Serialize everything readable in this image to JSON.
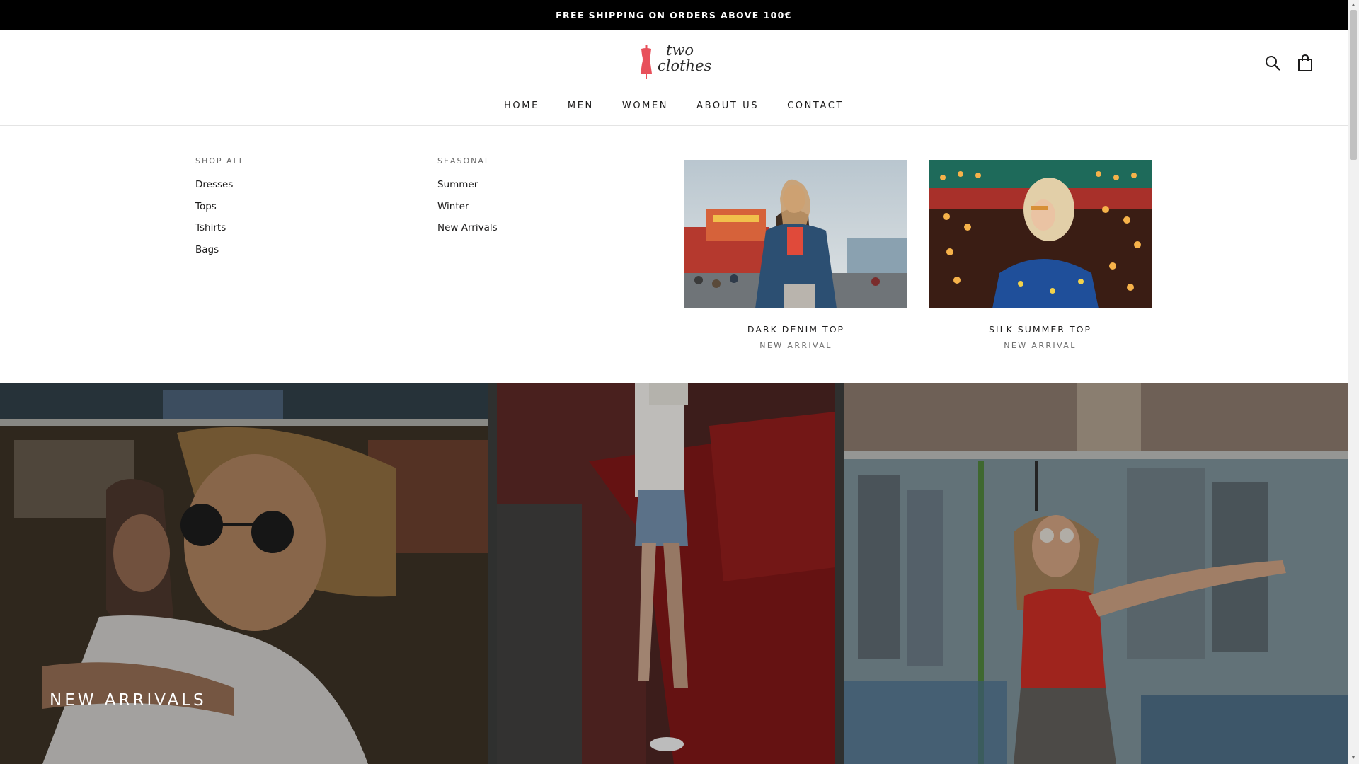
{
  "announcement": "FREE SHIPPING ON ORDERS ABOVE 100€",
  "brand": {
    "line1": "two",
    "line2": "clothes",
    "accent": "#e8505b"
  },
  "nav": {
    "items": [
      {
        "label": "HOME",
        "state": "active"
      },
      {
        "label": "MEN",
        "state": ""
      },
      {
        "label": "WOMEN",
        "state": "open"
      },
      {
        "label": "ABOUT US",
        "state": ""
      },
      {
        "label": "CONTACT",
        "state": ""
      }
    ]
  },
  "header_icons": [
    "search-icon",
    "shopping-bag-icon"
  ],
  "mega_menu": {
    "shop_all": {
      "title": "SHOP ALL",
      "links": [
        "Dresses",
        "Tops",
        "Tshirts",
        "Bags"
      ]
    },
    "seasonal": {
      "title": "SEASONAL",
      "links": [
        "Summer",
        "Winter",
        "New Arrivals"
      ]
    },
    "promos": [
      {
        "name": "DARK DENIM TOP",
        "subtitle": "NEW ARRIVAL"
      },
      {
        "name": "SILK SUMMER TOP",
        "subtitle": "NEW ARRIVAL"
      }
    ]
  },
  "hero": {
    "caption": "NEW ARRIVALS"
  }
}
